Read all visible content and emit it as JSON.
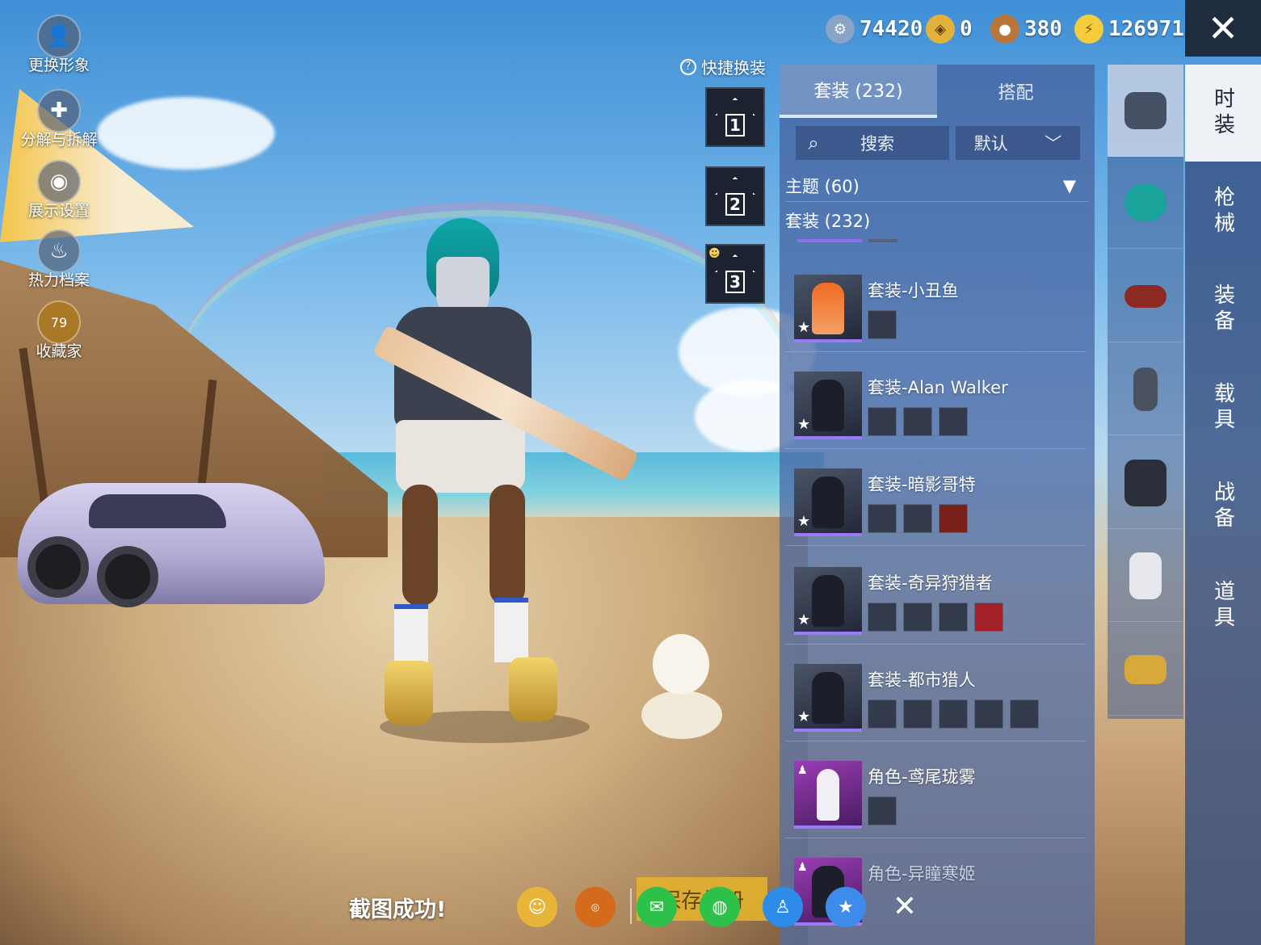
{
  "left_menu": [
    {
      "label": "更换形象",
      "icon": "avatar-icon"
    },
    {
      "label": "分解与拆解",
      "icon": "puzzle-icon"
    },
    {
      "label": "展示设置",
      "icon": "eye-icon"
    },
    {
      "label": "热力档案",
      "icon": "flame-icon"
    },
    {
      "label": "收藏家",
      "icon": "collector-badge-icon",
      "badge": "79"
    }
  ],
  "currency": [
    {
      "icon": "silver-coin-icon",
      "value": "74420",
      "color": "#8aa3c9"
    },
    {
      "icon": "token-icon",
      "value": "0",
      "color": "#e2b13b"
    },
    {
      "icon": "bronze-coin-icon",
      "value": "380",
      "color": "#b8763a"
    },
    {
      "icon": "energy-icon",
      "value": "126971",
      "color": "#f3cd3c"
    }
  ],
  "quick_change": {
    "title": "快捷换装",
    "help": "?",
    "slots": [
      "1",
      "2",
      "3"
    ]
  },
  "tabs": [
    {
      "label": "套装 (232)",
      "active": true
    },
    {
      "label": "搭配",
      "active": false
    }
  ],
  "search": {
    "icon": "search-icon",
    "label": "搜索"
  },
  "sort": {
    "label": "默认",
    "icon": "chevron-down-icon"
  },
  "filters": {
    "theme": "主题 (60)",
    "theme_arrow": "▼",
    "suit": "套装 (232)"
  },
  "items": [
    {
      "name": "套装-小丑鱼",
      "thumb": "orange",
      "parts": 1,
      "role": false
    },
    {
      "name": "套装-Alan Walker",
      "thumb": "dark",
      "parts": 3,
      "role": false
    },
    {
      "name": "套装-暗影哥特",
      "thumb": "dark",
      "parts": 3,
      "role": false
    },
    {
      "name": "套装-奇异狩猎者",
      "thumb": "dark",
      "parts": 4,
      "role": false
    },
    {
      "name": "套装-都市猎人",
      "thumb": "dark",
      "parts": 5,
      "role": false
    },
    {
      "name": "角色-鸢尾珑雾",
      "thumb": "white",
      "parts": 1,
      "role": true
    },
    {
      "name": "角色-异瞳寒姬",
      "thumb": "dark",
      "parts": 1,
      "role": true
    }
  ],
  "categories": [
    {
      "icon": "outfit-box-icon",
      "active": true,
      "color": "#e8ecf3"
    },
    {
      "icon": "hair-icon",
      "active": false,
      "color": "#1aa39b"
    },
    {
      "icon": "headwear-icon",
      "active": false,
      "color": "#8a2a22"
    },
    {
      "icon": "mask-icon",
      "active": false,
      "color": "#4a5262"
    },
    {
      "icon": "jacket-icon",
      "active": false,
      "color": "#2b2f3a"
    },
    {
      "icon": "pants-icon",
      "active": false,
      "color": "#e7e7ee"
    },
    {
      "icon": "shoes-icon",
      "active": false,
      "color": "#d7a93a"
    }
  ],
  "side_nav": [
    {
      "label": "时装",
      "active": true
    },
    {
      "label": "枪械",
      "active": false
    },
    {
      "label": "装备",
      "active": false
    },
    {
      "label": "载具",
      "active": false
    },
    {
      "label": "战备",
      "active": false
    },
    {
      "label": "道具",
      "active": false
    }
  ],
  "close_label": "✕",
  "share_bar": {
    "toast": "截图成功!",
    "save_label": "保存相册",
    "buttons": [
      {
        "icon": "friends-share-icon",
        "color": "#e9b43a"
      },
      {
        "icon": "game-share-icon",
        "color": "#d46a1c"
      },
      {
        "icon": "wechat-icon",
        "color": "#2ec14a"
      },
      {
        "icon": "moments-icon",
        "color": "#2ec14a"
      },
      {
        "icon": "qq-icon",
        "color": "#2d8ce8"
      },
      {
        "icon": "qzone-icon",
        "color": "#3d8bea"
      }
    ],
    "close": "✕"
  }
}
